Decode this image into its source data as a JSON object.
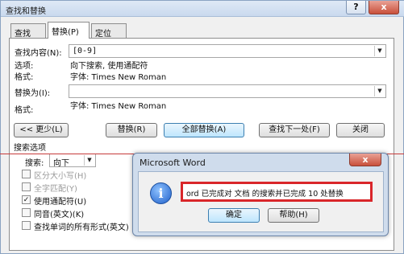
{
  "window": {
    "title": "查找和替换",
    "help_btn": "?",
    "close_btn": "x"
  },
  "tabs": [
    {
      "label": "查找(D)"
    },
    {
      "label": "替换(P)"
    },
    {
      "label": "定位(G)"
    }
  ],
  "find": {
    "label": "查找内容(N):",
    "value": "[0-9]",
    "options_label": "选项:",
    "options_value": "向下搜索, 使用通配符",
    "format_label": "格式:",
    "format_value": "字体: Times New Roman"
  },
  "replace": {
    "label": "替换为(I):",
    "value": "",
    "format_label": "格式:",
    "format_value": "字体: Times New Roman"
  },
  "buttons": {
    "less": "<< 更少(L)",
    "replace": "替换(R)",
    "replace_all": "全部替换(A)",
    "find_next": "查找下一处(F)",
    "close": "关闭"
  },
  "search_options": {
    "heading": "搜索选项",
    "search_label": "搜索:",
    "search_value": "向下",
    "checkboxes": [
      {
        "label": "区分大小写(H)",
        "checked": false,
        "enabled": false
      },
      {
        "label": "全字匹配(Y)",
        "checked": false,
        "enabled": false
      },
      {
        "label": "使用通配符(U)",
        "checked": true,
        "enabled": true
      },
      {
        "label": "同音(英文)(K)",
        "checked": false,
        "enabled": true
      },
      {
        "label": "查找单词的所有形式(英文)",
        "checked": false,
        "enabled": true
      }
    ]
  },
  "message_box": {
    "title": "Microsoft Word",
    "close_btn": "x",
    "icon_glyph": "i",
    "message": "ord 已完成对 文档 的搜索并已完成 10 处替换",
    "ok": "确定",
    "help": "帮助(H)"
  }
}
